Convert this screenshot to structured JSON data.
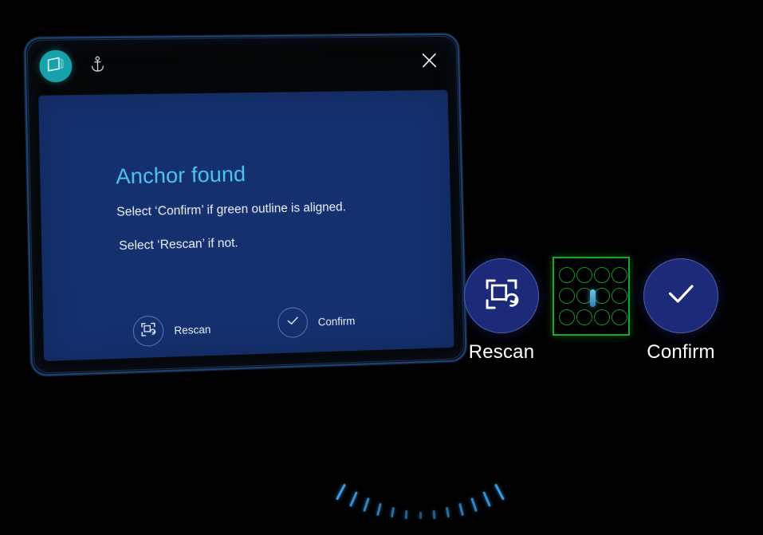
{
  "app": {
    "badge_icon": "holographic-panel-icon",
    "anchor_icon": "anchor-icon",
    "close_icon": "close-x-icon"
  },
  "dialog": {
    "title": "Anchor found",
    "line1": "Select ‘Confirm’ if green outline is aligned.",
    "line2": "Select ‘Rescan’ if not.",
    "actions": [
      {
        "id": "rescan",
        "label": "Rescan",
        "icon": "rescan-scan-refresh-icon"
      },
      {
        "id": "confirm",
        "label": "Confirm",
        "icon": "checkmark-icon"
      }
    ]
  },
  "holo_buttons": [
    {
      "id": "rescan",
      "label": "Rescan",
      "icon": "rescan-scan-refresh-icon"
    },
    {
      "id": "confirm",
      "label": "Confirm",
      "icon": "checkmark-icon"
    }
  ],
  "anchor_outline": {
    "name": "green-alignment-outline",
    "grid_rows": 3,
    "grid_cols": 4,
    "marker": "blue-capsule-marker"
  },
  "colors": {
    "panel_body": "#14306e",
    "panel_frame_border": "#20416e",
    "heading": "#4fc3f1",
    "badge_teal": "#17a2ab",
    "holo_button": "#1d2a79",
    "outline_green": "#19a62b",
    "capsule_blue": "#4aa8d8",
    "arc_tick": "#3d9ade",
    "background": "#000000"
  },
  "arc": {
    "name": "scan-progress-arc",
    "tick_count": 13
  }
}
